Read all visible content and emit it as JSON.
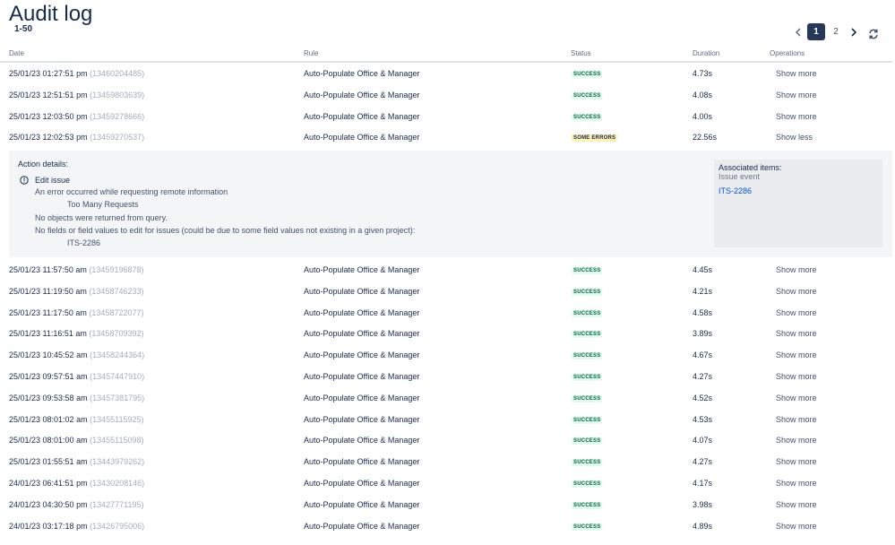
{
  "page": {
    "title": "Audit log",
    "range": "1-50"
  },
  "pagination": {
    "pages": [
      "1",
      "2"
    ],
    "current": "1"
  },
  "columns": {
    "date": "Date",
    "rule": "Rule",
    "status": "Status",
    "duration": "Duration",
    "operations": "Operations"
  },
  "rows": [
    {
      "date": "25/01/23 01:27:51 pm",
      "id": "(13460204485)",
      "rule": "Auto-Populate Office & Manager",
      "status": "SUCCESS",
      "duration": "4.73s",
      "op": "Show more"
    },
    {
      "date": "25/01/23 12:51:51 pm",
      "id": "(13459803639)",
      "rule": "Auto-Populate Office & Manager",
      "status": "SUCCESS",
      "duration": "4.08s",
      "op": "Show more"
    },
    {
      "date": "25/01/23 12:03:50 pm",
      "id": "(13459278666)",
      "rule": "Auto-Populate Office & Manager",
      "status": "SUCCESS",
      "duration": "4.00s",
      "op": "Show more"
    },
    {
      "date": "25/01/23 12:02:53 pm",
      "id": "(13459270537)",
      "rule": "Auto-Populate Office & Manager",
      "status": "SOME ERRORS",
      "duration": "22.56s",
      "op": "Show less"
    },
    {
      "date": "25/01/23 11:57:50 am",
      "id": "(13459196878)",
      "rule": "Auto-Populate Office & Manager",
      "status": "SUCCESS",
      "duration": "4.45s",
      "op": "Show more"
    },
    {
      "date": "25/01/23 11:19:50 am",
      "id": "(13458746233)",
      "rule": "Auto-Populate Office & Manager",
      "status": "SUCCESS",
      "duration": "4.21s",
      "op": "Show more"
    },
    {
      "date": "25/01/23 11:17:50 am",
      "id": "(13458722077)",
      "rule": "Auto-Populate Office & Manager",
      "status": "SUCCESS",
      "duration": "4.58s",
      "op": "Show more"
    },
    {
      "date": "25/01/23 11:16:51 am",
      "id": "(13458709392)",
      "rule": "Auto-Populate Office & Manager",
      "status": "SUCCESS",
      "duration": "3.89s",
      "op": "Show more"
    },
    {
      "date": "25/01/23 10:45:52 am",
      "id": "(13458244364)",
      "rule": "Auto-Populate Office & Manager",
      "status": "SUCCESS",
      "duration": "4.67s",
      "op": "Show more"
    },
    {
      "date": "25/01/23 09:57:51 am",
      "id": "(13457447910)",
      "rule": "Auto-Populate Office & Manager",
      "status": "SUCCESS",
      "duration": "4.27s",
      "op": "Show more"
    },
    {
      "date": "25/01/23 09:53:58 am",
      "id": "(13457381795)",
      "rule": "Auto-Populate Office & Manager",
      "status": "SUCCESS",
      "duration": "4.52s",
      "op": "Show more"
    },
    {
      "date": "25/01/23 08:01:02 am",
      "id": "(13455115925)",
      "rule": "Auto-Populate Office & Manager",
      "status": "SUCCESS",
      "duration": "4.53s",
      "op": "Show more"
    },
    {
      "date": "25/01/23 08:01:00 am",
      "id": "(13455115098)",
      "rule": "Auto-Populate Office & Manager",
      "status": "SUCCESS",
      "duration": "4.07s",
      "op": "Show more"
    },
    {
      "date": "25/01/23 01:55:51 am",
      "id": "(13443979262)",
      "rule": "Auto-Populate Office & Manager",
      "status": "SUCCESS",
      "duration": "4.27s",
      "op": "Show more"
    },
    {
      "date": "24/01/23 06:41:51 pm",
      "id": "(13430208146)",
      "rule": "Auto-Populate Office & Manager",
      "status": "SUCCESS",
      "duration": "4.17s",
      "op": "Show more"
    },
    {
      "date": "24/01/23 04:30:50 pm",
      "id": "(13427771195)",
      "rule": "Auto-Populate Office & Manager",
      "status": "SUCCESS",
      "duration": "3.98s",
      "op": "Show more"
    },
    {
      "date": "24/01/23 03:17:18 pm",
      "id": "(13426795006)",
      "rule": "Auto-Populate Office & Manager",
      "status": "SUCCESS",
      "duration": "4.89s",
      "op": "Show more"
    }
  ],
  "details": {
    "header": "Action details:",
    "action": "Edit issue",
    "lines": [
      "An error occurred while requesting remote information",
      "Too Many Requests",
      "No objects were returned from query.",
      "No fields or field values to edit for issues (could be due to some field values not existing in a given project):",
      "ITS-2286"
    ],
    "associated_title": "Associated items:",
    "associated_sub": "Issue event",
    "associated_link": "ITS-2286"
  },
  "colors": {
    "success_bg": "#e3fcef",
    "success_fg": "#006644",
    "errors_bg": "#fff0b3",
    "pager_active": "#253858",
    "link": "#0052cc"
  }
}
